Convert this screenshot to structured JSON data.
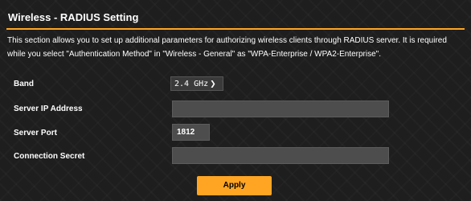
{
  "header": {
    "title": "Wireless - RADIUS Setting"
  },
  "description": "This section allows you to set up additional parameters for authorizing wireless clients through RADIUS server. It is required while you select \"Authentication Method\" in \"Wireless - General\" as \"WPA-Enterprise / WPA2-Enterprise\".",
  "form": {
    "band": {
      "label": "Band",
      "value": "2.4 GHz",
      "icon": "chevron-down-icon"
    },
    "server_ip": {
      "label": "Server IP Address",
      "value": ""
    },
    "server_port": {
      "label": "Server Port",
      "value": "1812"
    },
    "connection_secret": {
      "label": "Connection Secret",
      "value": ""
    }
  },
  "actions": {
    "apply_label": "Apply"
  },
  "colors": {
    "accent": "#ffa523",
    "background": "#1e1e1e",
    "field": "#4d4d4d"
  }
}
